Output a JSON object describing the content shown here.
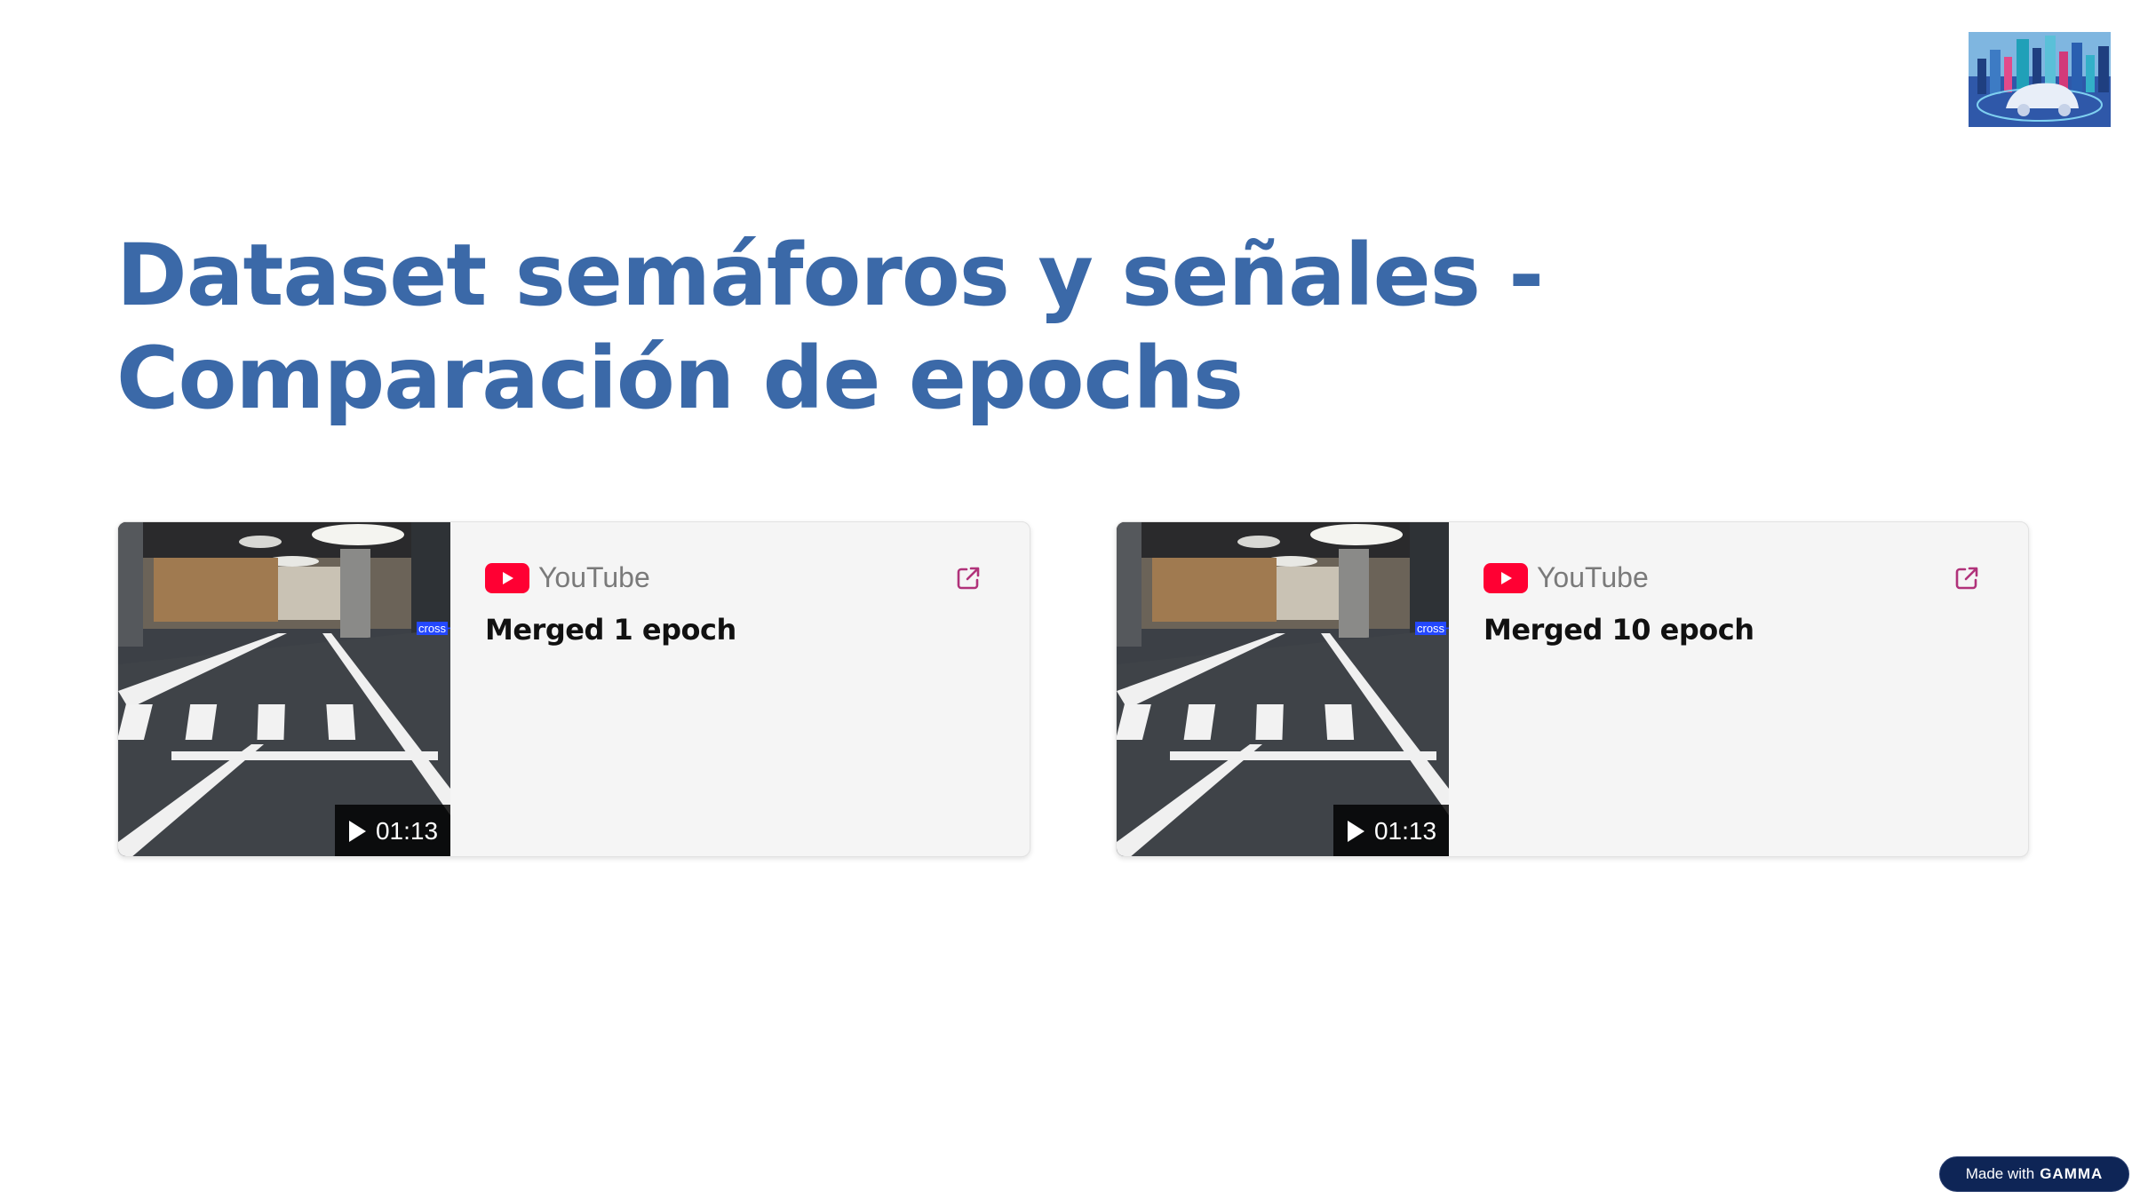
{
  "slide": {
    "title": "Dataset semáforos y señales - Comparación de epochs"
  },
  "videos": [
    {
      "source": "YouTube",
      "title": "Merged 1 epoch",
      "duration": "01:13",
      "overlay_label": "cross"
    },
    {
      "source": "YouTube",
      "title": "Merged 10 epoch",
      "duration": "01:13",
      "overlay_label": "cross"
    }
  ],
  "footer": {
    "made_with": "Made with",
    "brand": "GAMMA"
  },
  "colors": {
    "title": "#3b69a8",
    "youtube_red": "#ff0033",
    "external_link": "#b0327a",
    "badge_bg": "#0e2556"
  }
}
